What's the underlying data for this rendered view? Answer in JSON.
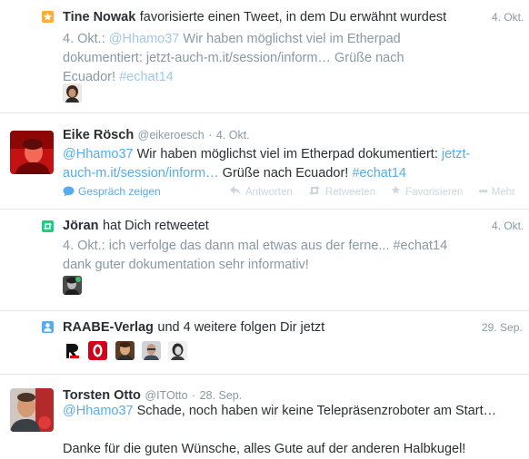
{
  "notifications": [
    {
      "type": "favorite",
      "actor": "Tine Nowak",
      "action": "favorisierte einen Tweet, in dem Du erwähnt wurdest",
      "date": "4. Okt.",
      "quote": {
        "prefix": "4. Okt.: ",
        "mention": "@Hhamo37",
        "text1": " Wir haben möglichst viel im Etherpad",
        "text2": "dokumentiert: jetzt-auch-m.it/session/inform… Grüße nach",
        "text3": "Ecuador! ",
        "hashtag": "#echat14"
      }
    },
    {
      "type": "tweet",
      "author": "Eike Rösch",
      "handle": "@eikeroesch",
      "dot": "·",
      "date": "4. Okt.",
      "mention": "@Hhamo37",
      "text1": " Wir haben möglichst viel im Etherpad dokumentiert: ",
      "link_part1": "jetzt-",
      "link_part2": "auch-m.it/session/inform…",
      "text2": " Grüße nach Ecuador! ",
      "hashtag": "#echat14",
      "conversation_label": "Gespräch zeigen",
      "actions": {
        "reply": "Antworten",
        "retweet": "Retweeten",
        "favorite": "Favorisieren",
        "more": "Mehr"
      }
    },
    {
      "type": "retweet",
      "actor": "Jöran",
      "action": "hat Dich retweetet",
      "date": "4. Okt.",
      "quote_line1": "4. Okt.: ich verfolge das dann mal etwas aus der ferne... #echat14",
      "quote_line2": "dank guter dokumentation sehr informativ!"
    },
    {
      "type": "follow",
      "actor": "RAABE-Verlag",
      "action": "und 4 weitere folgen Dir jetzt",
      "date": "29. Sep."
    },
    {
      "type": "tweet",
      "author": "Torsten Otto",
      "handle": "@ITOtto",
      "dot": "·",
      "date": "28. Sep.",
      "mention": "@Hhamo37",
      "text1": " Schade, noch haben wir keine Telepräsenzroboter am Start…",
      "text2": "Danke für die guten Wünsche, alles Gute auf der anderen Halbkugel!"
    }
  ],
  "colors": {
    "favorite": "#ffac33",
    "retweet": "#19cf86",
    "follow": "#55acee",
    "link": "#55acee",
    "muted": "#8899a6",
    "separator": "#e1e8ed"
  }
}
